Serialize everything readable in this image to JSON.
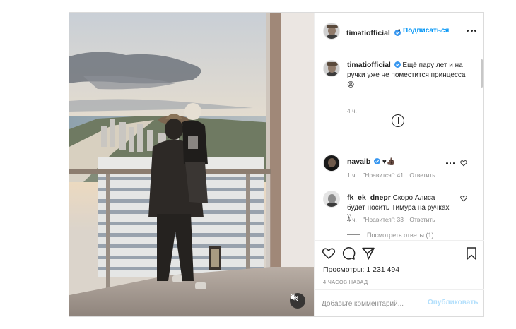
{
  "post": {
    "author": "timatiofficial",
    "follow_label": "Подписаться",
    "separator": "•",
    "more_icon": "more-horizontal-icon",
    "caption": "Ещё пару лет и на ручки уже не поместится принцесса 😩",
    "caption_time": "4 ч.",
    "load_more_icon": "plus-circle-icon"
  },
  "comments": [
    {
      "user": "navaib",
      "verified": true,
      "text": "♥👍🏿",
      "time": "1 ч.",
      "likes": "\"Нравится\": 41",
      "reply": "Ответить"
    },
    {
      "user": "fk_ek_dnepr",
      "verified": false,
      "text": "Скоро Алиса будет носить Тимура на ручках ))",
      "time": "4 ч.",
      "likes": "\"Нравится\": 33",
      "reply": "Ответить",
      "view_replies": "Посмотреть ответы (1)"
    }
  ],
  "actions": {
    "like_icon": "heart-icon",
    "comment_icon": "comment-icon",
    "share_icon": "share-icon",
    "save_icon": "bookmark-icon"
  },
  "stats": {
    "views_label": "Просмотры:",
    "views_value": "1 231 494",
    "posted_ago": "4 часов назад"
  },
  "add_comment": {
    "placeholder": "Добавьте комментарий...",
    "publish_label": "Опубликовать"
  },
  "media": {
    "mute_icon": "volume-muted-icon"
  },
  "colors": {
    "accent": "#0095f6",
    "publish_disabled": "#b2dffc",
    "border": "#dbdbdb",
    "muted_text": "#8e8e8e"
  }
}
